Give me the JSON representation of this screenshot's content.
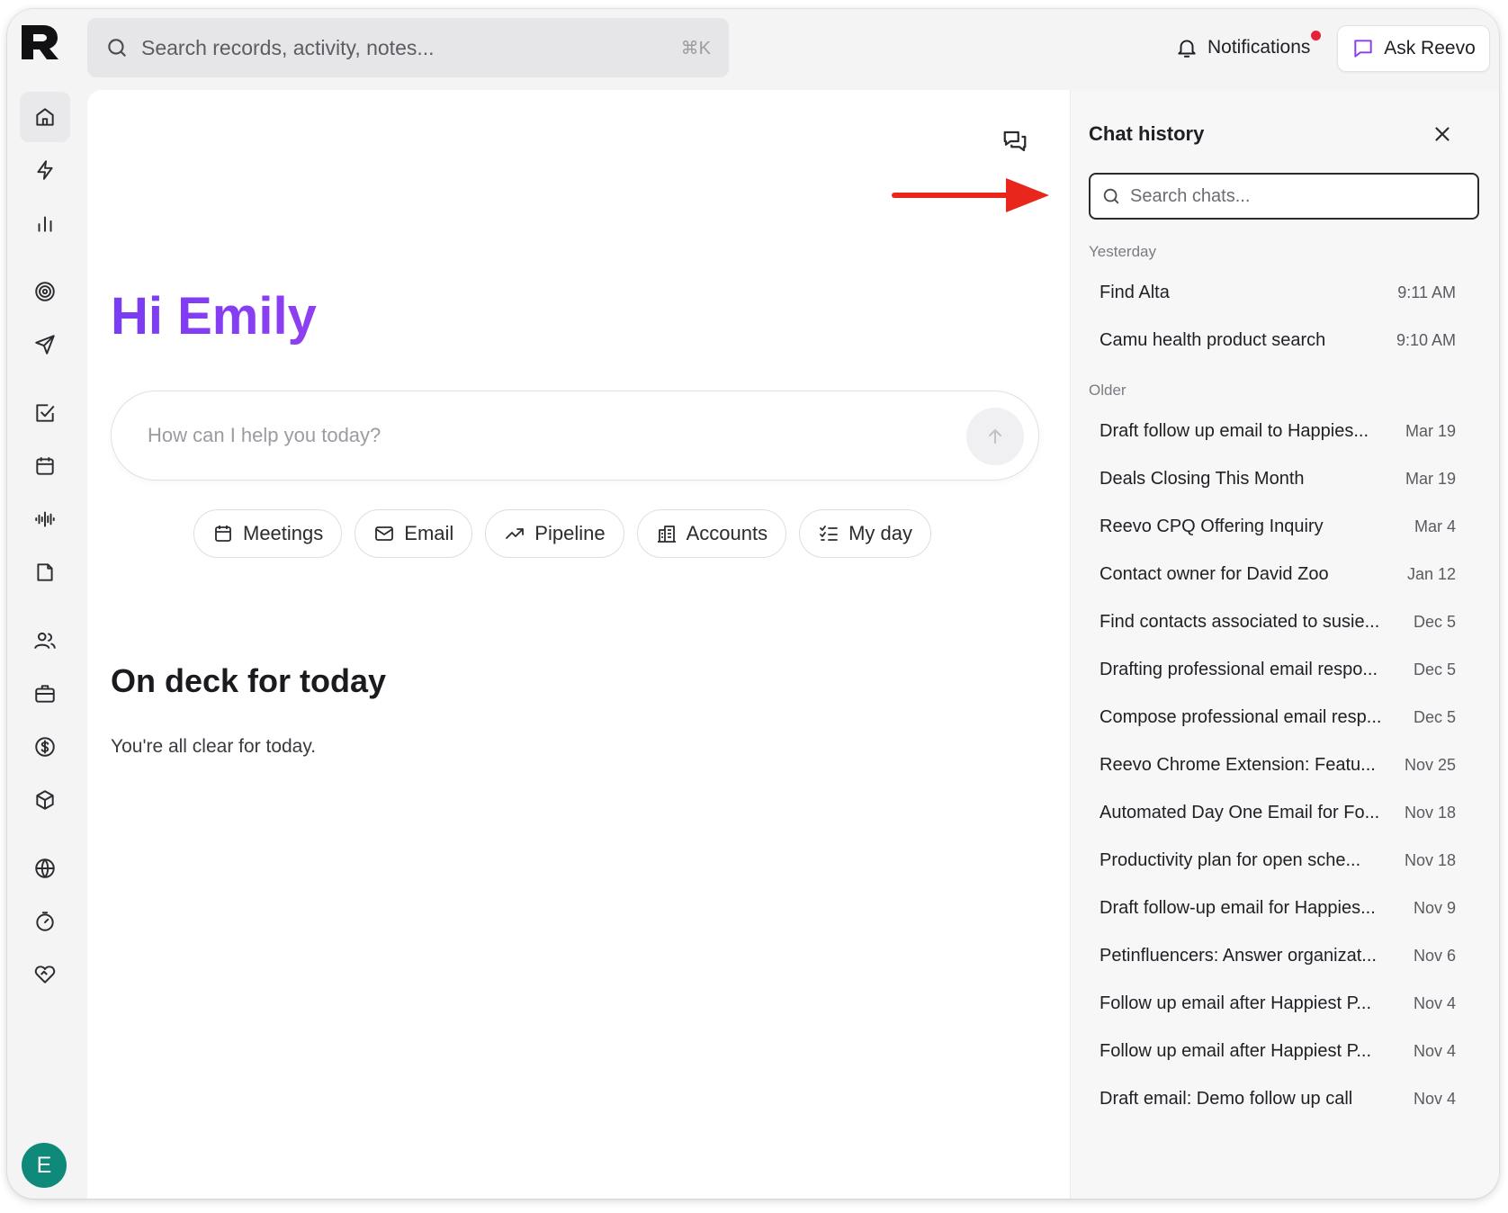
{
  "topbar": {
    "search_placeholder": "Search records, activity, notes...",
    "search_shortcut": "⌘K",
    "notifications_label": "Notifications",
    "notification_dot_color": "#e5213b",
    "ask_label": "Ask Reevo"
  },
  "rail": {
    "items": [
      {
        "icon": "home-icon",
        "active": true
      },
      {
        "icon": "lightning-icon"
      },
      {
        "icon": "bar-chart-icon"
      },
      {
        "icon": "target-icon"
      },
      {
        "icon": "send-icon"
      },
      {
        "icon": "checkbox-icon"
      },
      {
        "icon": "calendar-icon"
      },
      {
        "icon": "audio-wave-icon"
      },
      {
        "icon": "document-icon"
      },
      {
        "icon": "users-icon"
      },
      {
        "icon": "briefcase-icon"
      },
      {
        "icon": "dollar-icon"
      },
      {
        "icon": "package-icon"
      },
      {
        "icon": "globe-icon"
      },
      {
        "icon": "timer-icon"
      },
      {
        "icon": "handshake-heart-icon"
      }
    ],
    "avatar_initial": "E",
    "avatar_color": "#0f8a7a"
  },
  "main": {
    "greeting": "Hi Emily",
    "prompt_placeholder": "How can I help you today?",
    "chips": [
      {
        "label": "Meetings",
        "icon": "calendar-icon"
      },
      {
        "label": "Email",
        "icon": "mail-icon"
      },
      {
        "label": "Pipeline",
        "icon": "trending-up-icon"
      },
      {
        "label": "Accounts",
        "icon": "building-icon"
      },
      {
        "label": "My day",
        "icon": "checklist-icon"
      }
    ],
    "deck_title": "On deck for today",
    "deck_empty": "You're all clear for today."
  },
  "chat_history": {
    "title": "Chat history",
    "search_placeholder": "Search chats...",
    "groups": [
      {
        "label": "Yesterday",
        "items": [
          {
            "title": "Find Alta",
            "time": "9:11 AM"
          },
          {
            "title": "Camu health product search",
            "time": "9:10 AM"
          }
        ]
      },
      {
        "label": "Older",
        "items": [
          {
            "title": "Draft follow up email to Happies...",
            "time": "Mar 19"
          },
          {
            "title": "Deals Closing This Month",
            "time": "Mar 19"
          },
          {
            "title": "Reevo CPQ Offering Inquiry",
            "time": "Mar 4"
          },
          {
            "title": "Contact owner for David Zoo",
            "time": "Jan 12"
          },
          {
            "title": "Find contacts associated to susie...",
            "time": "Dec 5"
          },
          {
            "title": "Drafting professional email respo...",
            "time": "Dec 5"
          },
          {
            "title": "Compose professional email resp...",
            "time": "Dec 5"
          },
          {
            "title": "Reevo Chrome Extension: Featu...",
            "time": "Nov 25"
          },
          {
            "title": "Automated Day One Email for Fo...",
            "time": "Nov 18"
          },
          {
            "title": "Productivity plan for open sche...",
            "time": "Nov 18"
          },
          {
            "title": "Draft follow-up email for Happies...",
            "time": "Nov 9"
          },
          {
            "title": "Petinfluencers: Answer organizat...",
            "time": "Nov 6"
          },
          {
            "title": "Follow up email after Happiest P...",
            "time": "Nov 4"
          },
          {
            "title": "Follow up email after Happiest P...",
            "time": "Nov 4"
          },
          {
            "title": "Draft email: Demo follow up call",
            "time": "Nov 4"
          }
        ]
      }
    ]
  },
  "annotation": {
    "arrow_color": "#e8261c"
  },
  "colors": {
    "accent": "#7a3cf5",
    "ask_icon": "#8b3bf0"
  }
}
